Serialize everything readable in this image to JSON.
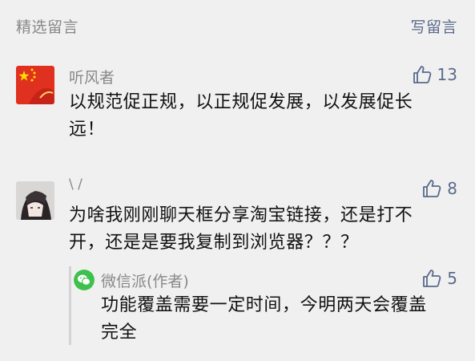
{
  "header": {
    "title": "精选留言",
    "write_label": "写留言"
  },
  "comments": [
    {
      "nickname": "听风者",
      "likes": "13",
      "text_line1": "以规范促正规，以正规促发展，以发展促长",
      "text_line2": "远！"
    },
    {
      "nickname": "\\ /",
      "likes": "8",
      "text_line1": "为啥我刚刚聊天框分享淘宝链接，还是打不",
      "text_line2": "开，还是是要我复制到浏览器？？？",
      "reply": {
        "nickname": "微信派(作者)",
        "likes": "5",
        "text_line1": "功能覆盖需要一定时间，今明两天会覆盖",
        "text_line2": "完全"
      }
    }
  ],
  "colors": {
    "background": "#f0f0f0",
    "muted_text": "#888888",
    "link_blue": "#5a6a8c",
    "wechat_green": "#3ec14c"
  },
  "icons": {
    "like": "thumbs-up-icon",
    "wechat": "wechat-logo-icon",
    "flag": "china-flag-avatar"
  }
}
